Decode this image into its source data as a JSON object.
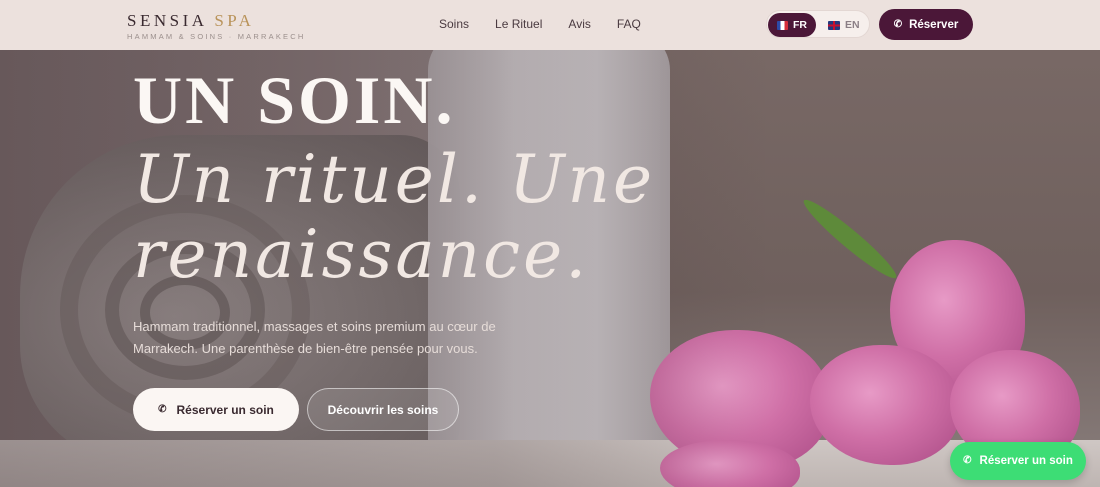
{
  "brand": {
    "name_part1": "SENSIA",
    "name_part2": "SPA",
    "tagline": "HAMMAM & SOINS · MARRAKECH",
    "accent_color": "#b9935a"
  },
  "nav": {
    "items": [
      {
        "label": "Soins"
      },
      {
        "label": "Le Rituel"
      },
      {
        "label": "Avis"
      },
      {
        "label": "FAQ"
      }
    ]
  },
  "language_switch": {
    "selected": "FR",
    "options": [
      {
        "label": "FR",
        "flag_icon": "flag-fr-icon"
      },
      {
        "label": "EN",
        "flag_icon": "flag-uk-icon"
      }
    ],
    "active_color": "#4b1738"
  },
  "header_cta": {
    "label": "Réserver",
    "icon": "phone-icon",
    "color": "#4b1738"
  },
  "hero": {
    "title_line1": "UN SOIN.",
    "title_line2": "Un rituel. Une",
    "title_line3": "renaissance.",
    "lead": "Hammam traditionnel, massages et soins premium au cœur de Marrakech. Une parenthèse de bien-être pensée pour vous.",
    "primary_cta": {
      "label": "Réserver un soin",
      "icon": "phone-icon"
    },
    "secondary_cta": {
      "label": "Découvrir les soins"
    }
  },
  "floating_cta": {
    "label": "Réserver un soin",
    "icon": "phone-icon",
    "color": "#3ddd75"
  }
}
